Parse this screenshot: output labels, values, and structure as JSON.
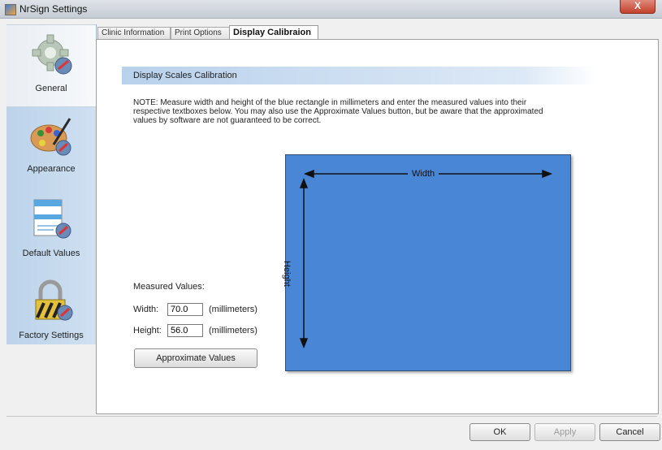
{
  "window": {
    "title": "NrSign Settings",
    "close_label": "X"
  },
  "sidebar": {
    "items": [
      {
        "label": "General",
        "icon": "gear-icon"
      },
      {
        "label": "Appearance",
        "icon": "palette-icon"
      },
      {
        "label": "Default Values",
        "icon": "document-icon"
      },
      {
        "label": "Factory Settings",
        "icon": "lock-icon"
      }
    ]
  },
  "tabs": [
    {
      "label": "Clinic Information"
    },
    {
      "label": "Print Options"
    },
    {
      "label": "Display Calibraion"
    }
  ],
  "calibration": {
    "section_title": "Display Scales Calibration",
    "note": "NOTE: Measure width and height of the blue rectangle in millimeters and enter the measured values into their respective textboxes below. You may also use the Approximate Values button, but be aware that the approximated values by software are not guaranteed to be correct.",
    "measured_title": "Measured Values:",
    "width_label": "Width:",
    "width_value": "70.0",
    "height_label": "Height:",
    "height_value": "56.0",
    "unit_label": "(millimeters)",
    "approx_button": "Approximate Values",
    "rect_width_label": "Width",
    "rect_height_label": "Height",
    "rect_color": "#4a86d6"
  },
  "footer": {
    "ok": "OK",
    "apply": "Apply",
    "cancel": "Cancel"
  }
}
